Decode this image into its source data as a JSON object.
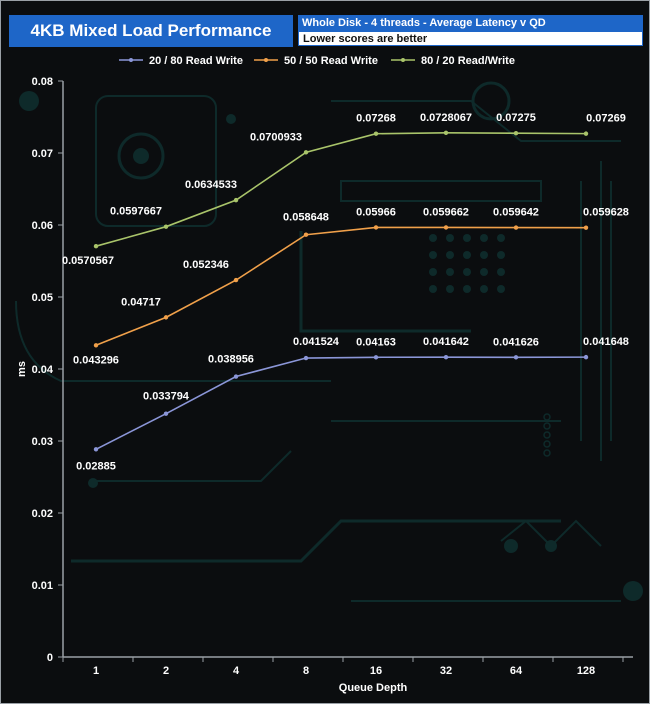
{
  "header": {
    "title": "4KB Mixed Load Performance",
    "subtitle": "Whole Disk - 4 threads - Average Latency v QD",
    "note": "Lower scores are better"
  },
  "colors": {
    "background": "#0b0d0f",
    "circuit": "#0e2a2a",
    "axis": "#9aa0a6",
    "text": "#ffffff",
    "title_bar": "#1e66c8"
  },
  "chart_data": {
    "type": "line",
    "categories": [
      "1",
      "2",
      "4",
      "8",
      "16",
      "32",
      "64",
      "128"
    ],
    "series": [
      {
        "name": "20 / 80 Read Write",
        "color": "#8b96d8",
        "values": [
          0.02885,
          0.033794,
          0.038956,
          0.041524,
          0.04163,
          0.041642,
          0.041626,
          0.041648
        ],
        "labels": [
          "0.02885",
          "0.033794",
          "0.038956",
          "0.041524",
          "0.04163",
          "0.041642",
          "0.041626",
          "0.041648"
        ]
      },
      {
        "name": "50 / 50 Read Write",
        "color": "#f0a04a",
        "values": [
          0.043296,
          0.04717,
          0.052346,
          0.058648,
          0.05966,
          0.059662,
          0.059642,
          0.059628
        ],
        "labels": [
          "0.043296",
          "0.04717",
          "0.052346",
          "0.058648",
          "0.05966",
          "0.059662",
          "0.059642",
          "0.059628"
        ]
      },
      {
        "name": "80 / 20 Read/Write",
        "color": "#a9c46a",
        "values": [
          0.0570567,
          0.0597667,
          0.0634533,
          0.0700933,
          0.07268,
          0.0728067,
          0.07275,
          0.07269
        ],
        "labels": [
          "0.0570567",
          "0.0597667",
          "0.0634533",
          "0.0700933",
          "0.07268",
          "0.0728067",
          "0.07275",
          "0.07269"
        ]
      }
    ],
    "xlabel": "Queue Depth",
    "ylabel": "ms",
    "ylim": [
      0,
      0.08
    ],
    "yticks": [
      "0",
      "0.01",
      "0.02",
      "0.03",
      "0.04",
      "0.05",
      "0.06",
      "0.07",
      "0.08"
    ],
    "legend_position": "top",
    "grid": false
  }
}
